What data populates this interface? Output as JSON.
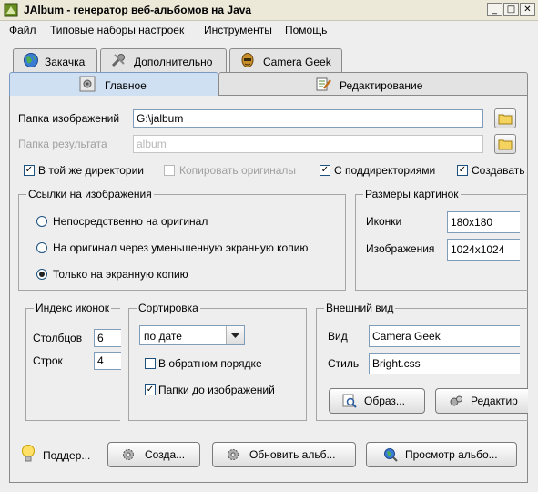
{
  "window": {
    "title": "JAlbum - генератор веб-альбомов на Java"
  },
  "menu": [
    "Файл",
    "Типовые наборы настроек",
    "Инструменты",
    "Помощь"
  ],
  "tabs_top": [
    {
      "label": "Закачка",
      "icon": "globe-icon"
    },
    {
      "label": "Дополнительно",
      "icon": "tools-icon"
    },
    {
      "label": "Camera Geek",
      "icon": "camera-geek-icon"
    }
  ],
  "tabs_main": [
    {
      "label": "Главное",
      "icon": "settings-icon",
      "active": true
    },
    {
      "label": "Редактирование",
      "icon": "edit-icon",
      "active": false
    }
  ],
  "paths": {
    "images_label": "Папка изображений",
    "images_value": "G:\\jalbum",
    "output_label": "Папка результата",
    "output_placeholder": "album"
  },
  "checkboxes": [
    {
      "label": "В той же директории",
      "checked": true,
      "disabled": false
    },
    {
      "label": "Копировать оригиналы",
      "checked": false,
      "disabled": true
    },
    {
      "label": "С поддиректориями",
      "checked": true,
      "disabled": false
    },
    {
      "label": "Создавать",
      "checked": true,
      "disabled": false
    }
  ],
  "links_group": {
    "title": "Ссылки на изображения",
    "options": [
      "Непосредственно на оригинал",
      "На оригинал через уменьшенную экранную копию",
      "Только на экранную копию"
    ],
    "selected_index": 2
  },
  "sizes_group": {
    "title": "Размеры картинок",
    "icons_label": "Иконки",
    "icons_value": "180x180",
    "images_label": "Изображения",
    "images_value": "1024x1024"
  },
  "index_group": {
    "title": "Индекс иконок",
    "cols_label": "Столбцов",
    "cols_value": "6",
    "rows_label": "Строк",
    "rows_value": "4"
  },
  "sort_group": {
    "title": "Сортировка",
    "selected": "по дате",
    "reverse_label": "В обратном порядке",
    "reverse_checked": false,
    "folders_first_label": "Папки до изображений",
    "folders_first_checked": true
  },
  "look_group": {
    "title": "Внешний вид",
    "view_label": "Вид",
    "view_value": "Camera Geek",
    "style_label": "Стиль",
    "style_value": "Bright.css",
    "sample_button": "Образ...",
    "edit_button": "Редактир"
  },
  "footer": {
    "support": "Поддер...",
    "create": "Созда...",
    "update": "Обновить альб...",
    "preview": "Просмотр альбо..."
  }
}
